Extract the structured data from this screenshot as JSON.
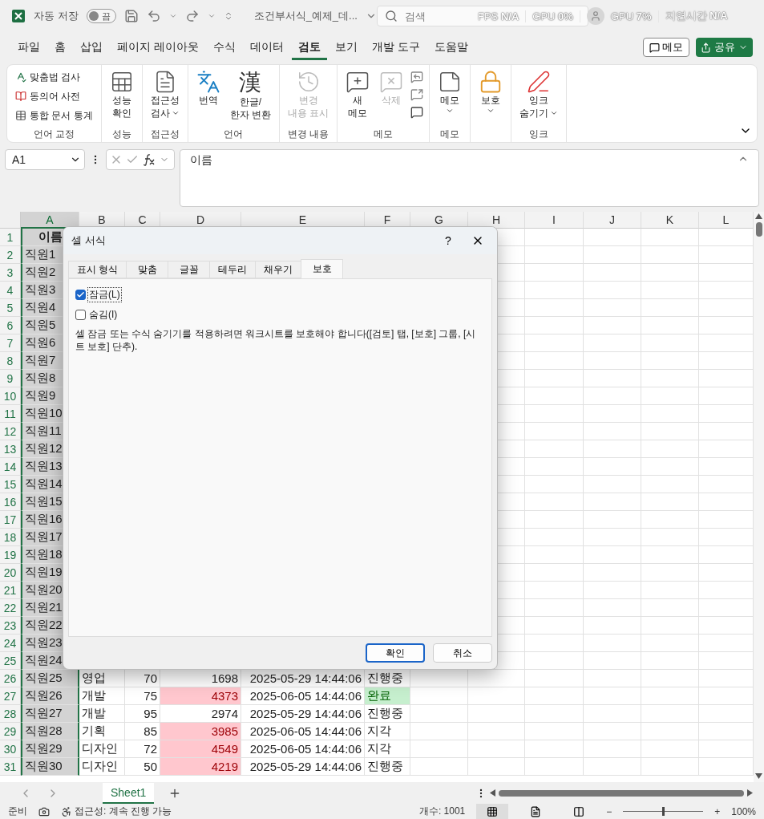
{
  "titlebar": {
    "autosave_label": "자동 저장",
    "autosave": {
      "on": false,
      "label": "끔"
    },
    "filename": "조건부서식_예제_데...",
    "search": {
      "placeholder": "검색"
    },
    "overlay": [
      {
        "label": "FPS",
        "value": "N/A"
      },
      {
        "label": "GPU",
        "value": "0%"
      },
      {
        "label": "GPU",
        "value": "7%"
      },
      {
        "label": "지연시간",
        "value": "N/A"
      }
    ]
  },
  "menu": {
    "tabs": [
      {
        "label": "파일",
        "selected": false
      },
      {
        "label": "홈",
        "selected": false
      },
      {
        "label": "삽입",
        "selected": false
      },
      {
        "label": "페이지 레이아웃",
        "selected": false
      },
      {
        "label": "수식",
        "selected": false
      },
      {
        "label": "데이터",
        "selected": false
      },
      {
        "label": "검토",
        "selected": true
      },
      {
        "label": "보기",
        "selected": false
      },
      {
        "label": "개발 도구",
        "selected": false
      },
      {
        "label": "도움말",
        "selected": false
      }
    ],
    "memo_button": "메모",
    "share_button": "공유"
  },
  "ribbon": {
    "groups": [
      {
        "label": "언어 교정",
        "items": [
          {
            "kind": "small",
            "lines": [
              "맞춤법 검사"
            ]
          },
          {
            "kind": "small",
            "lines": [
              "동의어 사전"
            ]
          },
          {
            "kind": "small",
            "lines": [
              "통합 문서 통계"
            ]
          }
        ]
      },
      {
        "label": "성능",
        "items": [
          {
            "kind": "large",
            "lines": [
              "성능",
              "확인"
            ]
          }
        ]
      },
      {
        "label": "접근성",
        "items": [
          {
            "kind": "large",
            "lines": [
              "접근성",
              "검사"
            ],
            "dropdown": true
          }
        ]
      },
      {
        "label": "언어",
        "items": [
          {
            "kind": "large",
            "lines": [
              "번역"
            ]
          },
          {
            "kind": "glyph",
            "glyph": "漢",
            "lines": [
              "한글/",
              "한자 변환"
            ]
          }
        ]
      },
      {
        "label": "변경 내용",
        "items": [
          {
            "kind": "large",
            "lines": [
              "변경",
              "내용 표시"
            ],
            "disabled": true
          }
        ]
      },
      {
        "label": "메모",
        "items": [
          {
            "kind": "large",
            "lines": [
              "새",
              "메모"
            ]
          },
          {
            "kind": "large",
            "lines": [
              "삭제"
            ],
            "disabled": true
          },
          {
            "kind": "icons"
          }
        ]
      },
      {
        "label": "메모",
        "items": [
          {
            "kind": "large",
            "lines": [
              "메모"
            ],
            "dropdown": true
          }
        ]
      },
      {
        "items": [
          {
            "kind": "large",
            "lines": [
              "보호"
            ],
            "dropdown": true
          }
        ]
      },
      {
        "label": "잉크",
        "items": [
          {
            "kind": "large",
            "lines": [
              "잉크",
              "숨기기"
            ],
            "dropdown": true
          }
        ]
      }
    ]
  },
  "formula_bar": {
    "name_box": "A1",
    "formula": "이름"
  },
  "sheet": {
    "columns": [
      {
        "label": "A",
        "selected": true
      },
      {
        "label": "B",
        "selected": false
      },
      {
        "label": "C",
        "selected": false
      },
      {
        "label": "D",
        "selected": false
      },
      {
        "label": "E",
        "selected": false
      },
      {
        "label": "F",
        "selected": false
      },
      {
        "label": "G",
        "selected": false
      },
      {
        "label": "H",
        "selected": false
      },
      {
        "label": "I",
        "selected": false
      },
      {
        "label": "J",
        "selected": false
      },
      {
        "label": "K",
        "selected": false
      },
      {
        "label": "L",
        "selected": false
      }
    ],
    "rows": [
      {
        "num": "1",
        "cells": [
          {
            "text": "이름",
            "bold": true
          }
        ]
      },
      {
        "num": "2",
        "cells": [
          {
            "text": "직원1"
          }
        ]
      },
      {
        "num": "3",
        "cells": [
          {
            "text": "직원2"
          }
        ]
      },
      {
        "num": "4",
        "cells": [
          {
            "text": "직원3"
          }
        ]
      },
      {
        "num": "5",
        "cells": [
          {
            "text": "직원4"
          }
        ]
      },
      {
        "num": "6",
        "cells": [
          {
            "text": "직원5"
          }
        ]
      },
      {
        "num": "7",
        "cells": [
          {
            "text": "직원6"
          }
        ]
      },
      {
        "num": "8",
        "cells": [
          {
            "text": "직원7"
          }
        ]
      },
      {
        "num": "9",
        "cells": [
          {
            "text": "직원8"
          }
        ]
      },
      {
        "num": "10",
        "cells": [
          {
            "text": "직원9"
          }
        ]
      },
      {
        "num": "11",
        "cells": [
          {
            "text": "직원10"
          }
        ]
      },
      {
        "num": "12",
        "cells": [
          {
            "text": "직원11"
          }
        ]
      },
      {
        "num": "13",
        "cells": [
          {
            "text": "직원12"
          }
        ]
      },
      {
        "num": "14",
        "cells": [
          {
            "text": "직원13"
          }
        ]
      },
      {
        "num": "15",
        "cells": [
          {
            "text": "직원14"
          }
        ]
      },
      {
        "num": "16",
        "cells": [
          {
            "text": "직원15"
          }
        ]
      },
      {
        "num": "17",
        "cells": [
          {
            "text": "직원16"
          }
        ]
      },
      {
        "num": "18",
        "cells": [
          {
            "text": "직원17"
          }
        ]
      },
      {
        "num": "19",
        "cells": [
          {
            "text": "직원18"
          }
        ]
      },
      {
        "num": "20",
        "cells": [
          {
            "text": "직원19"
          }
        ]
      },
      {
        "num": "21",
        "cells": [
          {
            "text": "직원20"
          }
        ]
      },
      {
        "num": "22",
        "cells": [
          {
            "text": "직원21"
          }
        ]
      },
      {
        "num": "23",
        "cells": [
          {
            "text": "직원22"
          }
        ]
      },
      {
        "num": "24",
        "cells": [
          {
            "text": "직원23"
          }
        ]
      },
      {
        "num": "25",
        "cells": [
          {
            "text": "직원24"
          }
        ]
      },
      {
        "num": "26",
        "cells": [
          {
            "text": "직원25"
          },
          {
            "text": "영업"
          },
          {
            "text": "70"
          },
          {
            "text": "1698"
          },
          {
            "text": "2025-05-29 14:44:06"
          },
          {
            "text": "진행중"
          }
        ]
      },
      {
        "num": "27",
        "cells": [
          {
            "text": "직원26"
          },
          {
            "text": "개발"
          },
          {
            "text": "75"
          },
          {
            "text": "4373",
            "kind": "bad"
          },
          {
            "text": "2025-06-05 14:44:06"
          },
          {
            "text": "완료",
            "kind": "good"
          }
        ]
      },
      {
        "num": "28",
        "cells": [
          {
            "text": "직원27"
          },
          {
            "text": "개발"
          },
          {
            "text": "95"
          },
          {
            "text": "2974"
          },
          {
            "text": "2025-05-29 14:44:06"
          },
          {
            "text": "진행중"
          }
        ]
      },
      {
        "num": "29",
        "cells": [
          {
            "text": "직원28"
          },
          {
            "text": "기획"
          },
          {
            "text": "85"
          },
          {
            "text": "3985",
            "kind": "bad"
          },
          {
            "text": "2025-06-05 14:44:06"
          },
          {
            "text": "지각"
          }
        ]
      },
      {
        "num": "30",
        "cells": [
          {
            "text": "직원29"
          },
          {
            "text": "디자인"
          },
          {
            "text": "72"
          },
          {
            "text": "4549",
            "kind": "bad"
          },
          {
            "text": "2025-06-05 14:44:06"
          },
          {
            "text": "지각"
          }
        ]
      },
      {
        "num": "31",
        "cells": [
          {
            "text": "직원30"
          },
          {
            "text": "디자인"
          },
          {
            "text": "50"
          },
          {
            "text": "4219",
            "kind": "bad"
          },
          {
            "text": "2025-05-29 14:44:06"
          },
          {
            "text": "진행중"
          }
        ]
      }
    ]
  },
  "dialog": {
    "title": "셀 서식",
    "help": "?",
    "tabs": [
      {
        "label": "표시 형식",
        "selected": false
      },
      {
        "label": "맞춤",
        "selected": false
      },
      {
        "label": "글꼴",
        "selected": false
      },
      {
        "label": "테두리",
        "selected": false
      },
      {
        "label": "채우기",
        "selected": false
      },
      {
        "label": "보호",
        "selected": true
      }
    ],
    "options": [
      {
        "label": "잠금(L)",
        "checked": true,
        "focused": true
      },
      {
        "label": "숨김(I)",
        "checked": false,
        "focused": false
      }
    ],
    "note": "셀 잠금 또는 수식 숨기기를 적용하려면 워크시트를 보호해야 합니다([검토] 탭, [보호] 그룹, [시트 보호] 단추).",
    "buttons": [
      {
        "label": "확인",
        "default": true
      },
      {
        "label": "취소",
        "default": false
      }
    ]
  },
  "sheet_tabs": [
    {
      "label": "Sheet1",
      "selected": true
    }
  ],
  "status_bar": {
    "ready": "준비",
    "accessibility": "접근성: 계속 진행 가능",
    "count": "개수: 1001",
    "views": [
      {
        "selected": true
      },
      {
        "selected": false
      },
      {
        "selected": false
      }
    ],
    "zoom": {
      "minus": "−",
      "plus": "+",
      "level": 0.5,
      "reading": "100%"
    }
  }
}
